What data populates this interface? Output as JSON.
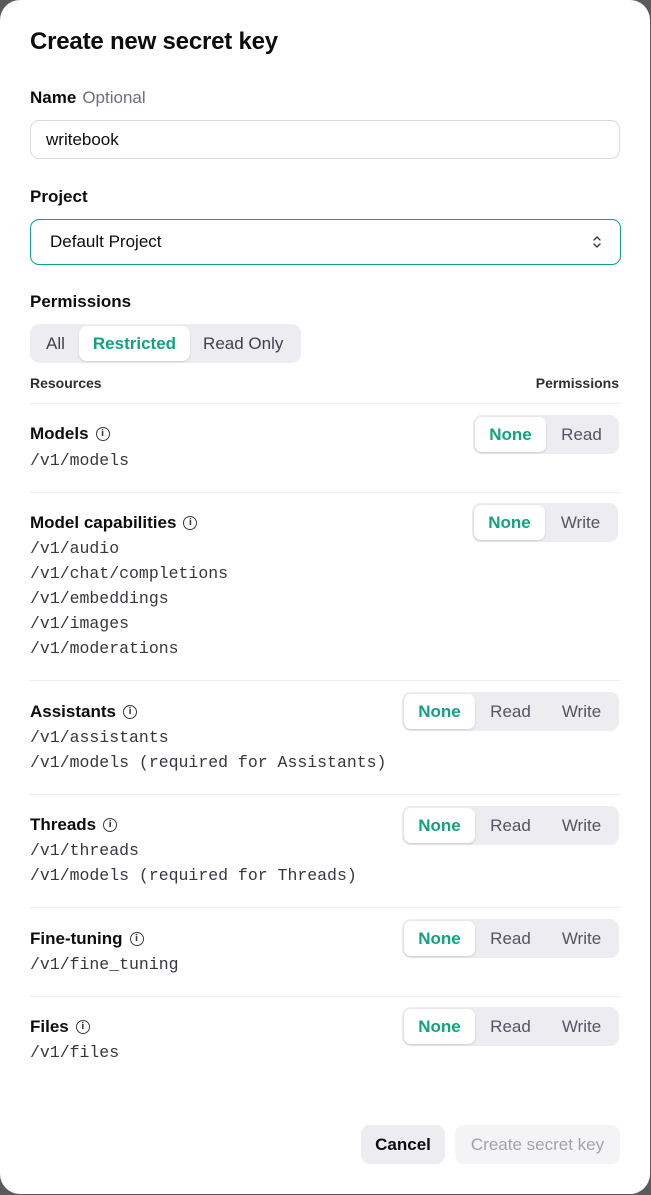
{
  "dialog": {
    "title": "Create new secret key"
  },
  "name_field": {
    "label": "Name",
    "optional": "Optional",
    "value": "writebook"
  },
  "project": {
    "label": "Project",
    "selected": "Default Project"
  },
  "permissions": {
    "label": "Permissions",
    "modes": [
      "All",
      "Restricted",
      "Read Only"
    ],
    "active_mode": "Restricted",
    "resources_header": "Resources",
    "permissions_header": "Permissions"
  },
  "resources": [
    {
      "title": "Models",
      "endpoints": [
        "/v1/models"
      ],
      "options": [
        "None",
        "Read"
      ],
      "selected": "None"
    },
    {
      "title": "Model capabilities",
      "endpoints": [
        "/v1/audio",
        "/v1/chat/completions",
        "/v1/embeddings",
        "/v1/images",
        "/v1/moderations"
      ],
      "options": [
        "None",
        "Write"
      ],
      "selected": "None"
    },
    {
      "title": "Assistants",
      "endpoints": [
        "/v1/assistants",
        "/v1/models (required for Assistants)"
      ],
      "options": [
        "None",
        "Read",
        "Write"
      ],
      "selected": "None"
    },
    {
      "title": "Threads",
      "endpoints": [
        "/v1/threads",
        "/v1/models (required for Threads)"
      ],
      "options": [
        "None",
        "Read",
        "Write"
      ],
      "selected": "None"
    },
    {
      "title": "Fine-tuning",
      "endpoints": [
        "/v1/fine_tuning"
      ],
      "options": [
        "None",
        "Read",
        "Write"
      ],
      "selected": "None"
    },
    {
      "title": "Files",
      "endpoints": [
        "/v1/files"
      ],
      "options": [
        "None",
        "Read",
        "Write"
      ],
      "selected": "None"
    }
  ],
  "actions": {
    "cancel": "Cancel",
    "create": "Create secret key"
  },
  "colors": {
    "accent": "#10a37f",
    "segment_bg": "#ececf1"
  }
}
